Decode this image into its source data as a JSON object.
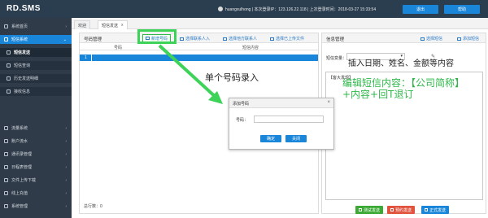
{
  "header": {
    "logo": "RD.SMS",
    "user_info": "huangxulhong  |  本次登录IP：123.126.22.118  |  上次登录时间：2018-03-27 15:33:54",
    "exit_label": "退出",
    "help_label": "帮助"
  },
  "sidebar": {
    "items": [
      {
        "label": "系统首页",
        "icon": "home-icon"
      },
      {
        "label": "短信系统",
        "icon": "envelope-icon"
      },
      {
        "label": "短信发送",
        "icon": "send-icon"
      },
      {
        "label": "短信查询",
        "icon": "search-icon"
      },
      {
        "label": "历史发送明细",
        "icon": "history-icon"
      },
      {
        "label": "接收信息",
        "icon": "inbox-icon"
      },
      {
        "label": "流量系统",
        "icon": "traffic-icon"
      },
      {
        "label": "账户流水",
        "icon": "account-icon"
      },
      {
        "label": "通讯录管理",
        "icon": "contacts-icon"
      },
      {
        "label": "日程表管理",
        "icon": "calendar-icon"
      },
      {
        "label": "文件上传下载",
        "icon": "file-icon"
      },
      {
        "label": "线上充值",
        "icon": "recharge-icon"
      },
      {
        "label": "系统管理",
        "icon": "gear-icon"
      }
    ]
  },
  "tabs": [
    {
      "label": "欢迎"
    },
    {
      "label": "短信发送",
      "close": "x"
    }
  ],
  "number_panel": {
    "title": "号码管理",
    "buttons": {
      "new_number": "新增号码",
      "select_contacts": "选择联系人入",
      "select_other_contacts": "选择他方联系人",
      "select_uploaded": "选择已上传文件"
    },
    "columns": [
      "号码",
      "短信内容"
    ],
    "rows": [
      {
        "index": "1",
        "number": "",
        "content": ""
      }
    ],
    "total": "总行数：0"
  },
  "annotations": {
    "single_number": "单个号码录入",
    "insert_hint": "插入日期、姓名、金额等内容",
    "edit_hint": "编辑短信内容：【公司简称】+内容+回T退订"
  },
  "dialog": {
    "title": "添加号码",
    "close": "×",
    "field_label": "号码：",
    "field_value": "",
    "ok_label": "确定",
    "cancel_label": "关闭"
  },
  "info_panel": {
    "title": "信息管理",
    "select_template": "选择短信",
    "add_template": "添加短信",
    "variable_label": "短信变量：",
    "variable_value": "",
    "message_prefix": "【客大发现】"
  },
  "actions": {
    "test_send": "测试发送",
    "timed_send": "预约发送",
    "formal_send": "正式发送"
  },
  "colors": {
    "header_bg": "#2b3e50",
    "sidebar_bg": "#2f3b49",
    "accent": "#1a86d9",
    "highlight_green": "#3dd258",
    "annotation_green": "#2fb84a"
  }
}
